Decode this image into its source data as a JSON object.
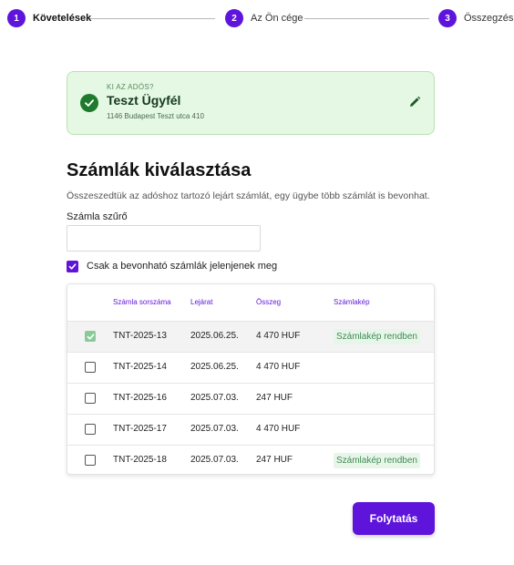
{
  "stepper": {
    "steps": [
      {
        "number": "1",
        "label": "Követelések"
      },
      {
        "number": "2",
        "label": "Az Ön cége"
      },
      {
        "number": "3",
        "label": "Összegzés"
      }
    ]
  },
  "debtor": {
    "caption": "KI AZ ADÓS?",
    "name": "Teszt Ügyfél",
    "address": "1146 Budapest Teszt utca 410"
  },
  "invoices": {
    "title": "Számlák kiválasztása",
    "description": "Összeszedtük az adóshoz tartozó lejárt számlát, egy ügybe több számlát is bevonhat.",
    "filter_label": "Számla szűrő",
    "filter_value": "",
    "only_eligible_label": "Csak a bevonható számlák jelenjenek meg",
    "only_eligible_checked": true
  },
  "table": {
    "headers": {
      "number": "Számla sorszáma",
      "due": "Lejárat",
      "amount": "Összeg",
      "image": "Számlakép"
    },
    "rows": [
      {
        "checked": true,
        "number": "TNT-2025-13",
        "due": "2025.06.25.",
        "amount": "4 470 HUF",
        "status": "Számlakép rendben"
      },
      {
        "checked": false,
        "number": "TNT-2025-14",
        "due": "2025.06.25.",
        "amount": "4 470 HUF",
        "status": ""
      },
      {
        "checked": false,
        "number": "TNT-2025-16",
        "due": "2025.07.03.",
        "amount": "247 HUF",
        "status": ""
      },
      {
        "checked": false,
        "number": "TNT-2025-17",
        "due": "2025.07.03.",
        "amount": "4 470 HUF",
        "status": ""
      },
      {
        "checked": false,
        "number": "TNT-2025-18",
        "due": "2025.07.03.",
        "amount": "247 HUF",
        "status": "Számlakép rendben"
      }
    ]
  },
  "actions": {
    "continue_label": "Folytatás"
  },
  "colors": {
    "accent": "#5f14dc",
    "success_bg": "#e5f8e3",
    "success_dark": "#1f7a2e"
  },
  "icons": {
    "debtor_status": "check-circle-icon",
    "edit": "pencil-icon",
    "checkbox": "checkmark-icon"
  }
}
